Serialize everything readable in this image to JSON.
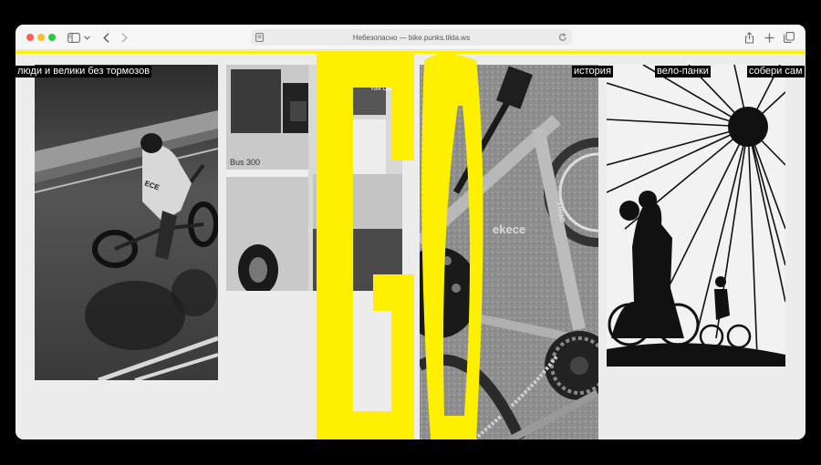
{
  "browser": {
    "address": "Небезопасно — bike.punks.tilda.ws",
    "icons": [
      "sidebar-icon",
      "chevron-down-icon",
      "back-icon",
      "forward-icon",
      "page-icon",
      "reload-icon",
      "share-icon",
      "new-tab-icon",
      "tabs-overview-icon"
    ]
  },
  "site": {
    "tagline": "люди и велики без тормозов",
    "nav": [
      "история",
      "вело-панки",
      "собери сам"
    ],
    "photo_text": {
      "bus_sign": "York City",
      "frame_brand": "ekece",
      "frame_logo": "Tlluc"
    },
    "accent_color": "#fff000"
  }
}
